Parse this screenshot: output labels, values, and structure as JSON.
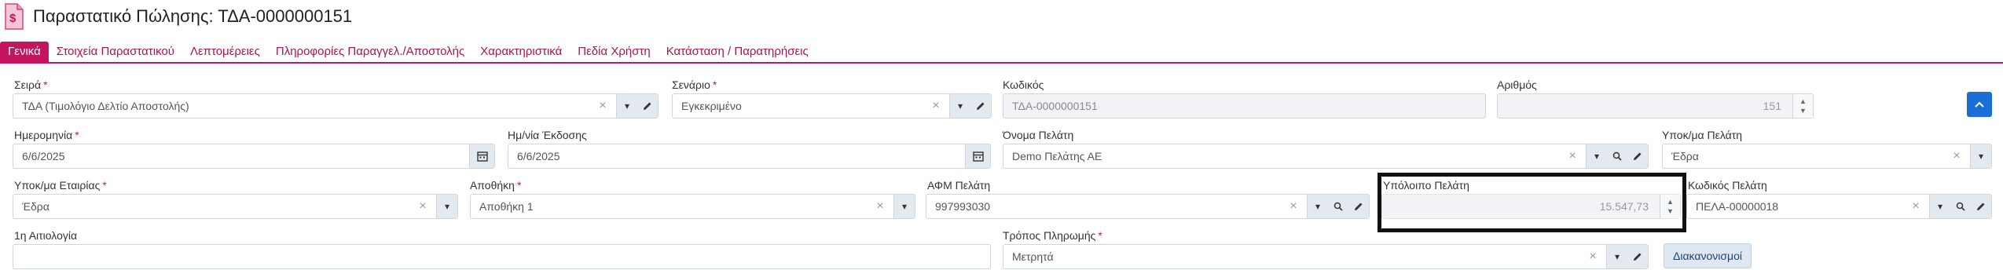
{
  "header": {
    "title": "Παραστατικό Πώλησης: ΤΔΑ-0000000151",
    "doc_icon_glyph": "$",
    "doc_icon_color": "#d1457a"
  },
  "tabs": [
    {
      "label": "Γενικά",
      "active": true
    },
    {
      "label": "Στοιχεία Παραστατικού"
    },
    {
      "label": "Λεπτομέρειες"
    },
    {
      "label": "Πληροφορίες Παραγγελ./Αποστολής"
    },
    {
      "label": "Χαρακτηριστικά"
    },
    {
      "label": "Πεδία Χρήστη"
    },
    {
      "label": "Κατάσταση / Παρατηρήσεις"
    }
  ],
  "fields": {
    "series": {
      "label": "Σειρά",
      "required_mark": "*",
      "value": "ΤΔΑ (Τιμολόγιο Δελτίο Αποστολής)"
    },
    "scenario": {
      "label": "Σενάριο",
      "required_mark": "*",
      "value": "Εγκεκριμένο"
    },
    "code": {
      "label": "Κωδικός",
      "value": "ΤΔΑ-0000000151"
    },
    "number": {
      "label": "Αριθμός",
      "value": "151"
    },
    "date": {
      "label": "Ημερομηνία",
      "required_mark": "*",
      "value": "6/6/2025"
    },
    "issue_date": {
      "label": "Ημ/νία Έκδοσης",
      "value": "6/6/2025"
    },
    "customer_name": {
      "label": "Όνομα Πελάτη",
      "value": "Demo Πελάτης ΑΕ"
    },
    "customer_branch": {
      "label": "Υποκ/μα Πελάτη",
      "value": "Έδρα"
    },
    "company_branch": {
      "label": "Υποκ/μα Εταιρίας",
      "required_mark": "*",
      "value": "Έδρα"
    },
    "warehouse": {
      "label": "Αποθήκη",
      "required_mark": "*",
      "value": "Αποθήκη 1"
    },
    "vat": {
      "label": "ΑΦΜ Πελάτη",
      "value": "997993030"
    },
    "balance": {
      "label": "Υπόλοιπο Πελάτη",
      "value": "15.547,73"
    },
    "customer_code": {
      "label": "Κωδικός Πελάτη",
      "value": "ΠΕΛΑ-00000018"
    },
    "reason": {
      "label": "1η Αιτιολογία",
      "value": ""
    },
    "payment": {
      "label": "Τρόπος Πληρωμής",
      "required_mark": "*",
      "value": "Μετρητά"
    }
  },
  "buttons": {
    "settings": "Διακανονισμοί"
  },
  "glyphs": {
    "clear": "×",
    "dropdown": "▾",
    "spin_up": "▲",
    "spin_down": "▼"
  },
  "colors": {
    "accent": "#c4155d",
    "primary_button": "#1a6fd6"
  }
}
